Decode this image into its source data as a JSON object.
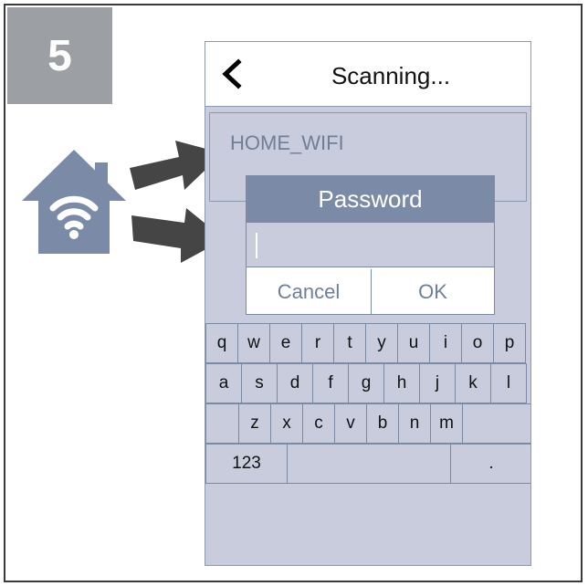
{
  "step_number": "5",
  "phone": {
    "title": "Scanning...",
    "network_name": "HOME_WIFI",
    "dialog": {
      "title": "Password",
      "password_value": "",
      "cancel_label": "Cancel",
      "ok_label": "OK"
    },
    "keyboard": {
      "row1": [
        "q",
        "w",
        "e",
        "r",
        "t",
        "y",
        "u",
        "i",
        "o",
        "p"
      ],
      "row2": [
        "a",
        "s",
        "d",
        "f",
        "g",
        "h",
        "j",
        "k",
        "l"
      ],
      "row3": [
        "z",
        "x",
        "c",
        "v",
        "b",
        "n",
        "m"
      ],
      "numbers_key": "123",
      "period_key": "."
    }
  },
  "colors": {
    "badge": "#9c9fa3",
    "house": "#7b8aa7",
    "arrow": "#454545",
    "phone_background": "#c9ccdd",
    "dialog_header": "#7b8aa7"
  }
}
